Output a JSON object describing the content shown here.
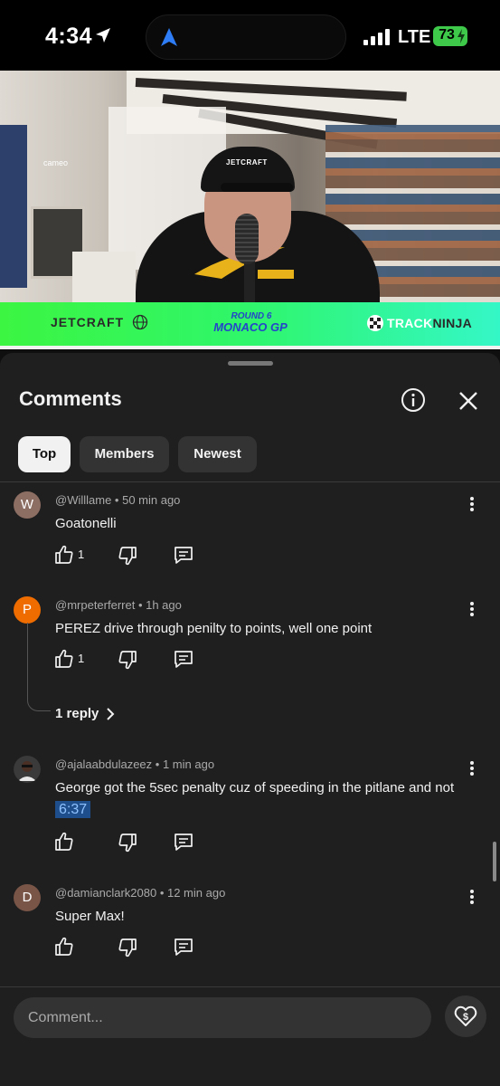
{
  "status_bar": {
    "time": "4:34",
    "network": "LTE",
    "battery": "73"
  },
  "video": {
    "cameo_label": "cameo",
    "cap_text": "JETCRAFT",
    "banner": {
      "sponsor_left": "JETCRAFT",
      "round": "ROUND 6",
      "race": "MONACO GP",
      "sponsor_right_a": "TRACK",
      "sponsor_right_b": "NINJA"
    },
    "progress": 1.0
  },
  "comments_panel": {
    "title": "Comments",
    "filters": [
      "Top",
      "Members",
      "Newest"
    ],
    "active_filter": "Top",
    "comments": [
      {
        "avatar_letter": "W",
        "avatar_color": "#8d6e63",
        "author": "@Willlame",
        "time": "50 min ago",
        "text": "Goatonelli",
        "likes": "1"
      },
      {
        "avatar_letter": "P",
        "avatar_color": "#ef6c00",
        "author": "@mrpeterferret",
        "time": "1h ago",
        "text": "PEREZ drive through penilty to points, well one point",
        "likes": "1",
        "replies_label": "1 reply"
      },
      {
        "avatar_letter": "",
        "avatar_color": "#3a3a3a",
        "author": "@ajalaabdulazeez",
        "time": "1 min ago",
        "text": "George got the 5sec penalty cuz of speeding in the pitlane and not",
        "timestamp_link": "6:37",
        "likes": ""
      },
      {
        "avatar_letter": "D",
        "avatar_color": "#795548",
        "author": "@damianclark2080",
        "time": "12 min ago",
        "text": "Super Max!",
        "likes": ""
      }
    ],
    "input_placeholder": "Comment..."
  },
  "colors": {
    "background": "#0f0f0f",
    "sheet": "#1f1f1f",
    "chip": "#333333",
    "banner_green": "#3cf542",
    "timestamp_link": "#1e4e8c"
  },
  "icons": [
    "location-arrow-icon",
    "navigation-arrow-icon",
    "signal-icon",
    "battery-icon",
    "info-icon",
    "close-icon",
    "like-icon",
    "dislike-icon",
    "reply-icon",
    "more-vertical-icon",
    "chevron-right-icon",
    "super-thanks-icon"
  ]
}
